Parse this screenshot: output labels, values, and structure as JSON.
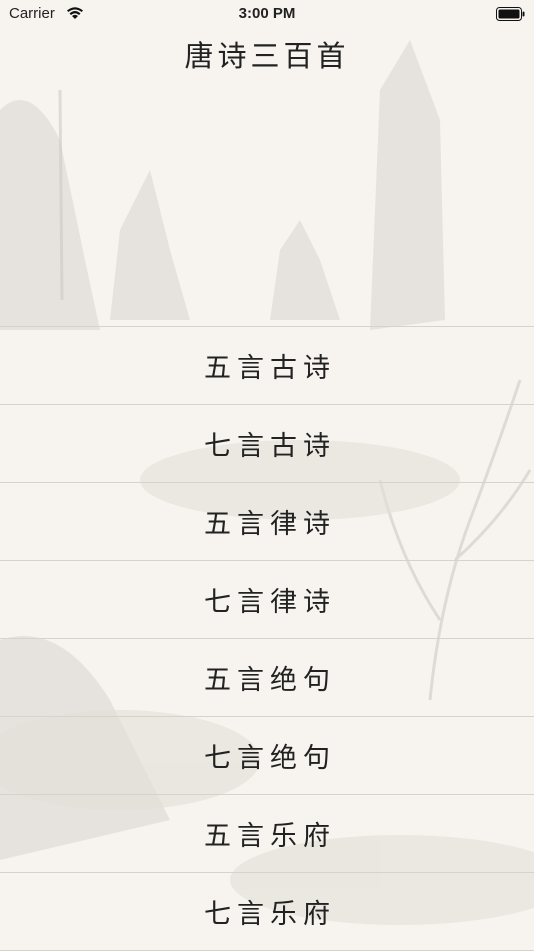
{
  "status_bar": {
    "carrier": "Carrier",
    "time": "3:00 PM"
  },
  "nav": {
    "title": "唐诗三百首"
  },
  "menu": {
    "items": [
      {
        "label": "五言古诗"
      },
      {
        "label": "七言古诗"
      },
      {
        "label": "五言律诗"
      },
      {
        "label": "七言律诗"
      },
      {
        "label": "五言绝句"
      },
      {
        "label": "七言绝句"
      },
      {
        "label": "五言乐府"
      },
      {
        "label": "七言乐府"
      }
    ]
  }
}
